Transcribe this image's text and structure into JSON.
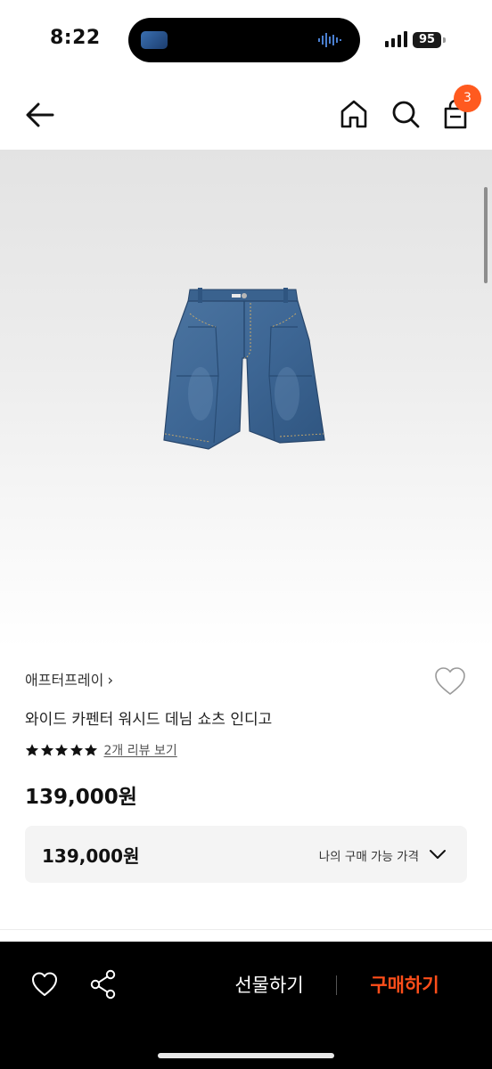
{
  "status_bar": {
    "time": "8:22",
    "battery": "95",
    "icons": [
      "signal-icon",
      "battery-icon",
      "audio-wave-icon"
    ]
  },
  "header": {
    "icons": [
      "back-arrow-icon",
      "home-icon",
      "search-icon",
      "shopping-bag-icon"
    ],
    "cart_count": "3",
    "badge_color": "#ff5a1f"
  },
  "product": {
    "brand": "애프터프레이",
    "title": "와이드 카펜터 워시드 데님 쇼츠 인디고",
    "rating": 5,
    "review_link": "2개 리뷰 보기",
    "price": "139,000원",
    "image": "denim-shorts-image"
  },
  "price_box": {
    "price": "139,000원",
    "label": "나의 구매 가능 가격"
  },
  "bottom_bar": {
    "gift_label": "선물하기",
    "buy_label": "구매하기",
    "buy_color": "#ff4e1a",
    "icons": [
      "heart-icon",
      "share-icon"
    ]
  }
}
